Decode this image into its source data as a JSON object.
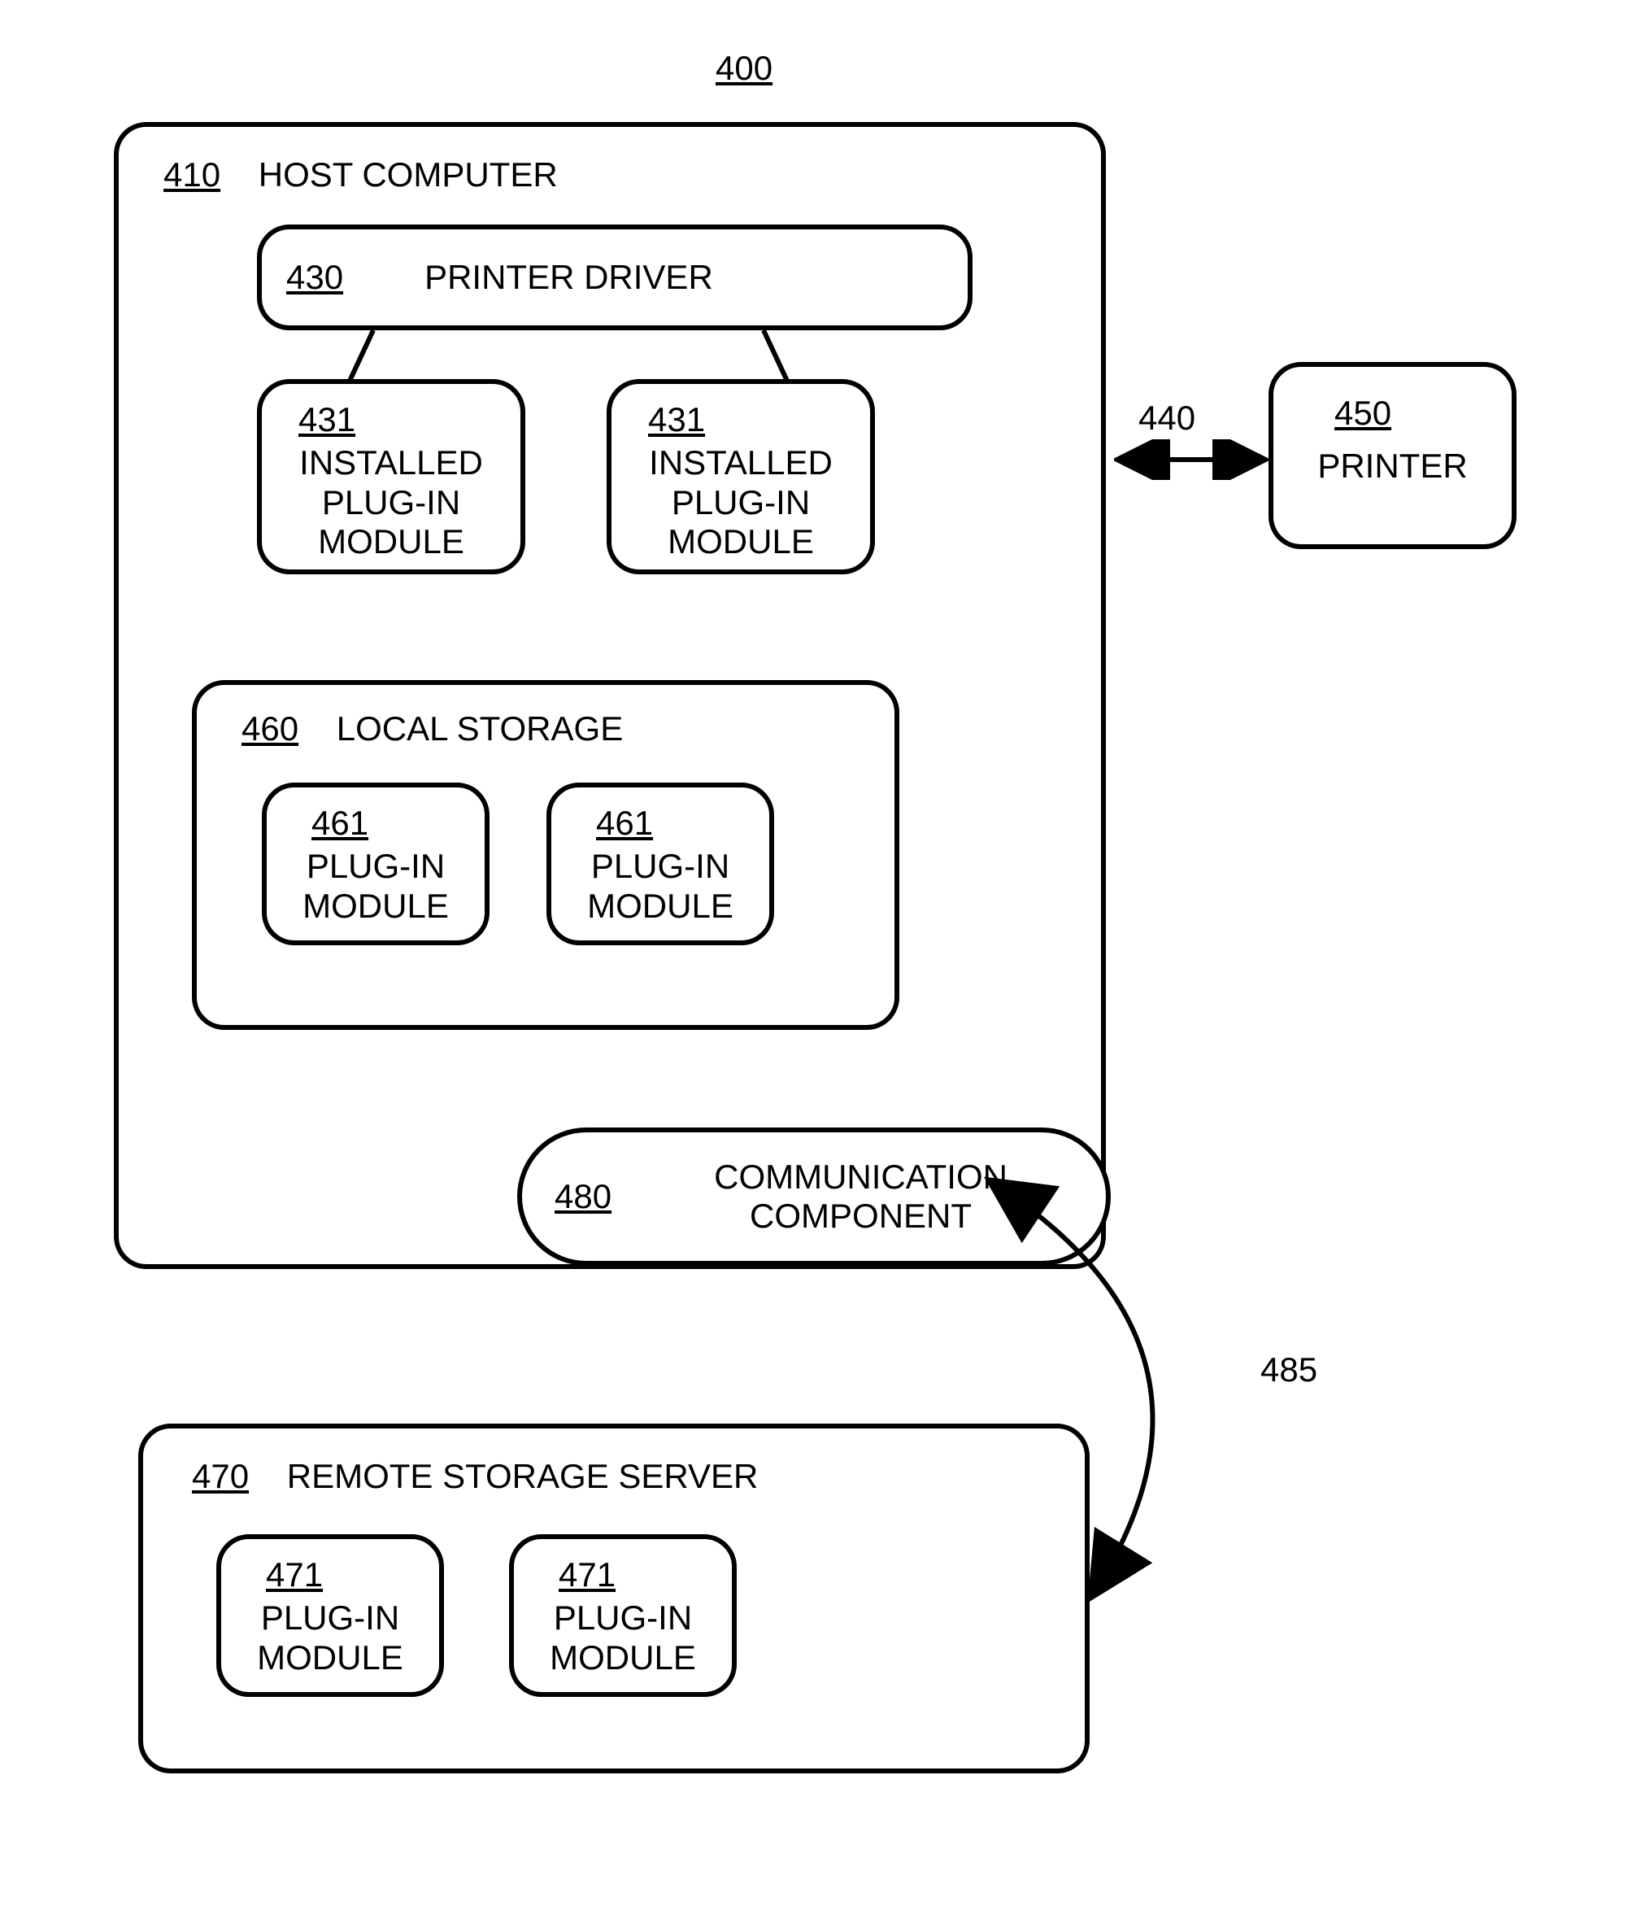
{
  "title_ref": "400",
  "host": {
    "ref": "410",
    "label": "HOST COMPUTER"
  },
  "driver": {
    "ref": "430",
    "label": "PRINTER DRIVER"
  },
  "plugin431a": {
    "ref": "431",
    "l1": "INSTALLED",
    "l2": "PLUG-IN",
    "l3": "MODULE"
  },
  "plugin431b": {
    "ref": "431",
    "l1": "INSTALLED",
    "l2": "PLUG-IN",
    "l3": "MODULE"
  },
  "local": {
    "ref": "460",
    "label": "LOCAL STORAGE"
  },
  "plugin461a": {
    "ref": "461",
    "l1": "PLUG-IN",
    "l2": "MODULE"
  },
  "plugin461b": {
    "ref": "461",
    "l1": "PLUG-IN",
    "l2": "MODULE"
  },
  "comm": {
    "ref": "480",
    "l1": "COMMUNICATION",
    "l2": "COMPONENT"
  },
  "printer": {
    "ref": "450",
    "label": "PRINTER"
  },
  "arrow440": "440",
  "remote": {
    "ref": "470",
    "label": "REMOTE STORAGE SERVER"
  },
  "plugin471a": {
    "ref": "471",
    "l1": "PLUG-IN",
    "l2": "MODULE"
  },
  "plugin471b": {
    "ref": "471",
    "l1": "PLUG-IN",
    "l2": "MODULE"
  },
  "arrow485": "485"
}
